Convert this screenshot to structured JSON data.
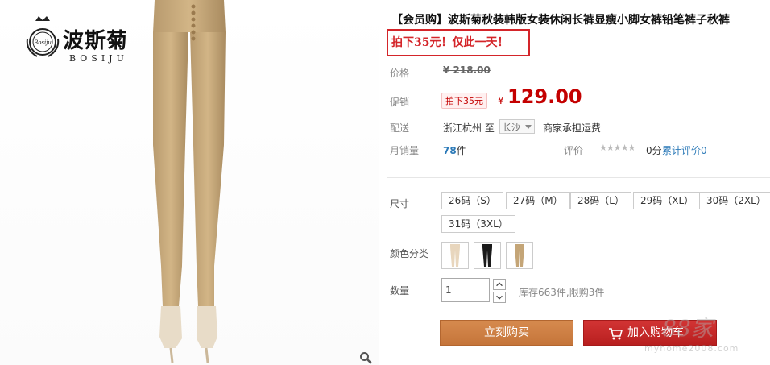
{
  "brand": {
    "name": "波斯菊",
    "sub": "BOSIJU",
    "seal_text": "Bosiju"
  },
  "product": {
    "title": "【会员购】波斯菊秋装韩版女装休闲长裤显瘦小脚女裤铅笔裤子秋裤",
    "promo_note": "拍下35元！仅此一天！"
  },
  "price": {
    "label": "价格",
    "original": "¥ 218.00"
  },
  "promotion": {
    "label": "促销",
    "tag": "拍下35元",
    "currency": "¥",
    "price": "129.00"
  },
  "shipping": {
    "label": "配送",
    "from": "浙江杭州 至",
    "to": "长沙",
    "fee": "商家承担运费"
  },
  "sales": {
    "label": "月销量",
    "count": "78",
    "unit": "件"
  },
  "rating": {
    "label": "评价",
    "stars": "★★★★★",
    "score": "0分",
    "review_link": "累计评价0"
  },
  "size": {
    "label": "尺寸",
    "options": [
      "26码（S）",
      "27码（M）",
      "28码（L）",
      "29码（XL）",
      "30码（2XL）",
      "31码（3XL）"
    ]
  },
  "color": {
    "label": "颜色分类",
    "swatches": [
      "beige",
      "black",
      "khaki"
    ]
  },
  "quantity": {
    "label": "数量",
    "value": "1",
    "stock": "库存663件,限购3件"
  },
  "actions": {
    "buy_now": "立刻购买",
    "add_to_cart": "加入购物车"
  },
  "watermark": {
    "big": "88家",
    "small": "myhome2008.com"
  },
  "colors": {
    "accent_red": "#c40000",
    "promo_border": "#d4252a",
    "buy_orange": "#c5753a",
    "link_blue": "#2c7ab8"
  }
}
